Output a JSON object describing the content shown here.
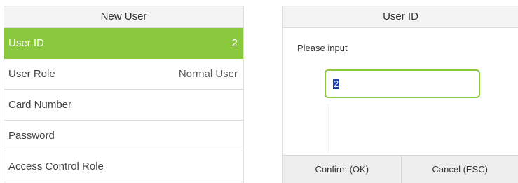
{
  "new_user_menu": {
    "title": "New User",
    "items": [
      {
        "label": "User ID",
        "value": "2",
        "selected": true
      },
      {
        "label": "User Role",
        "value": "Normal User",
        "selected": false
      },
      {
        "label": "Card Number",
        "value": "",
        "selected": false
      },
      {
        "label": "Password",
        "value": "",
        "selected": false
      },
      {
        "label": "Access Control Role",
        "value": "",
        "selected": false
      }
    ]
  },
  "user_id_dialog": {
    "title": "User ID",
    "prompt": "Please input",
    "input_value": "2",
    "confirm_label": "Confirm (OK)",
    "cancel_label": "Cancel (ESC)"
  },
  "colors": {
    "accent_green": "#8ac83e",
    "selection_blue": "#1f3fa8"
  }
}
